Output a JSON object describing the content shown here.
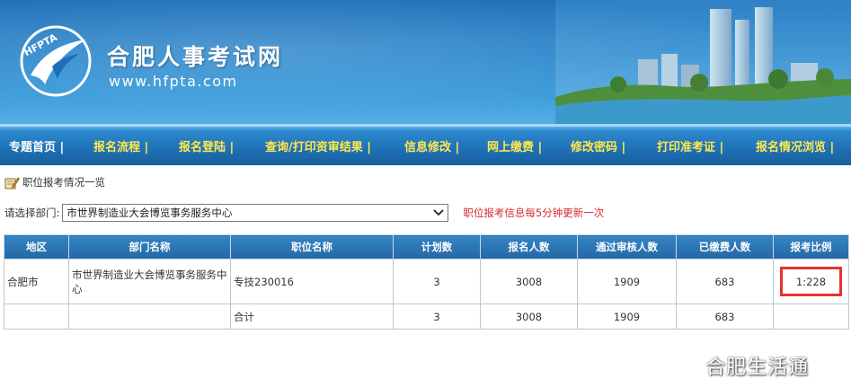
{
  "header": {
    "site_title": "合肥人事考试网",
    "site_url": "www.hfpta.com",
    "logo_text": "HFPTA"
  },
  "nav": {
    "items": [
      {
        "label": "专题首页 |"
      },
      {
        "label": "报名流程 |"
      },
      {
        "label": "报名登陆 |"
      },
      {
        "label": "查询/打印资审结果 |"
      },
      {
        "label": "信息修改 |"
      },
      {
        "label": "网上缴费 |"
      },
      {
        "label": "修改密码 |"
      },
      {
        "label": "打印准考证 |"
      },
      {
        "label": "报名情况浏览 |"
      }
    ]
  },
  "breadcrumb": {
    "label": "职位报考情况一览"
  },
  "filter": {
    "label": "请选择部门:",
    "selected": "市世界制造业大会博览事务服务中心",
    "note": "职位报考信息每5分钟更新一次"
  },
  "table": {
    "headers": [
      "地区",
      "部门名称",
      "职位名称",
      "计划数",
      "报名人数",
      "通过审核人数",
      "已缴费人数",
      "报考比例"
    ],
    "rows": [
      {
        "region": "合肥市",
        "department": "市世界制造业大会博览事务服务中心",
        "position": "专技230016",
        "planned": "3",
        "applicants": "3008",
        "approved": "1909",
        "paid": "683",
        "ratio": "1:228"
      }
    ],
    "total": {
      "label": "合计",
      "planned": "3",
      "applicants": "3008",
      "approved": "1909",
      "paid": "683"
    }
  },
  "watermark": {
    "text": "合肥生活通"
  },
  "colors": {
    "banner": "#2a86cc",
    "nav_text": "#ffe94d",
    "table_header": "#2770ae",
    "highlight": "#e63232",
    "note": "#d62a2a"
  }
}
